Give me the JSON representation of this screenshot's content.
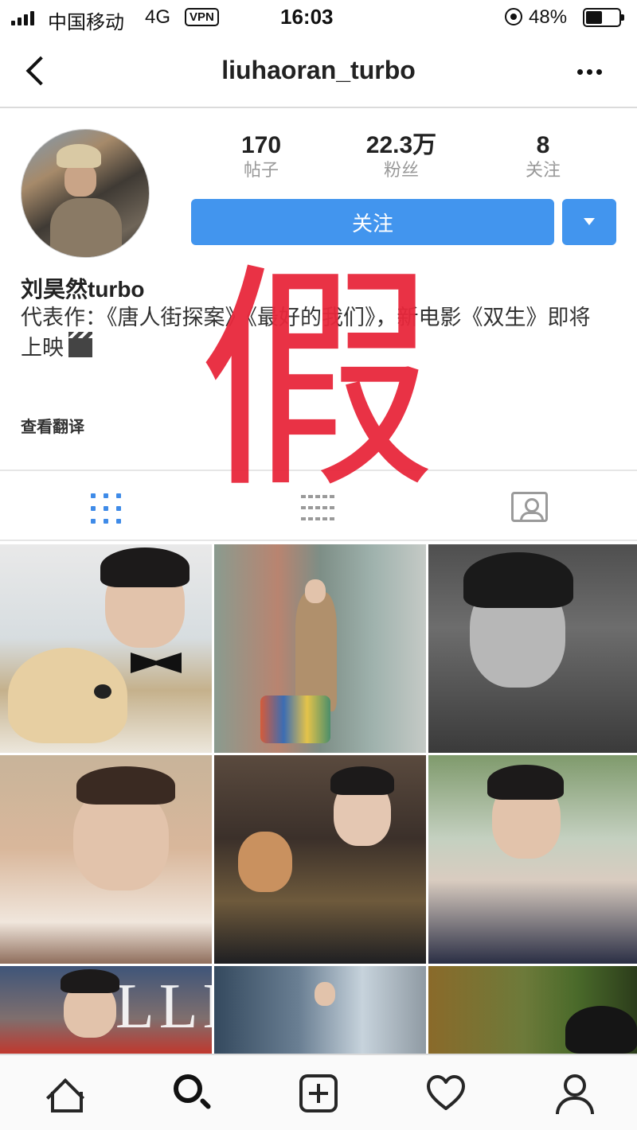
{
  "status_bar": {
    "carrier": "中国移动",
    "network": "4G",
    "vpn": "VPN",
    "time": "16:03",
    "battery": "48%"
  },
  "nav": {
    "title": "liuhaoran_turbo",
    "back_icon": "chevron-left-icon",
    "more_icon": "more-horizontal-icon"
  },
  "profile": {
    "stats": [
      {
        "value": "170",
        "label": "帖子"
      },
      {
        "value": "22.3万",
        "label": "粉丝"
      },
      {
        "value": "8",
        "label": "关注"
      }
    ],
    "follow_label": "关注",
    "name": "刘昊然turbo",
    "bio": "代表作：《唐人街探案》《最好的我们》，新电影《双生》即将上映",
    "see_translation": "查看翻译"
  },
  "watermark": "假",
  "tabs": [
    {
      "name": "grid",
      "icon": "grid-icon",
      "active": true
    },
    {
      "name": "list",
      "icon": "list-icon",
      "active": false
    },
    {
      "name": "tagged",
      "icon": "tagged-photo-icon",
      "active": false
    }
  ],
  "grid_photos": 9,
  "photo_text": {
    "elle": "ELLE"
  },
  "bottom_nav": [
    "home-icon",
    "search-icon",
    "add-post-icon",
    "heart-icon",
    "profile-icon"
  ],
  "colors": {
    "accent": "#4295ee",
    "watermark": "#e8283c",
    "stat_label": "#999999"
  }
}
